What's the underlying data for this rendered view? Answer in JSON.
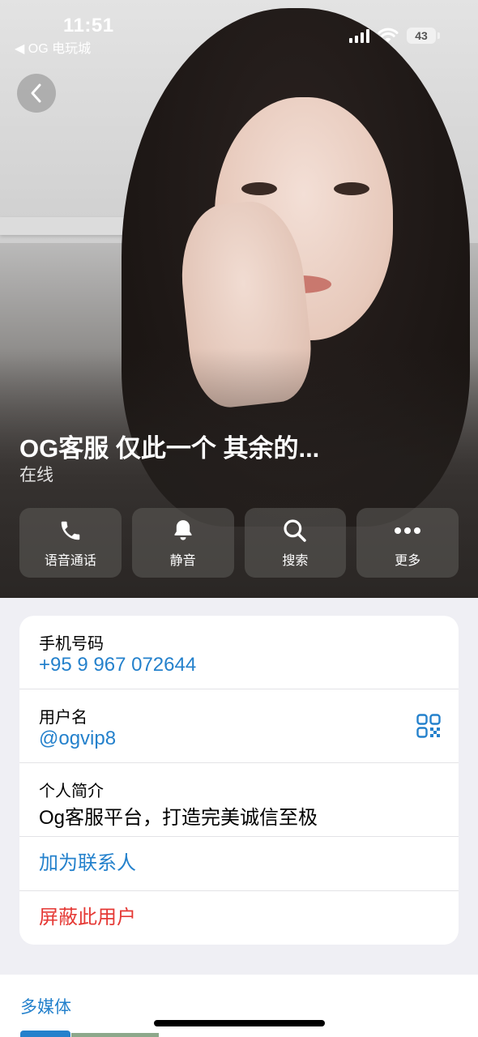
{
  "status_bar": {
    "time": "11:51",
    "back_app": "◀ OG 电玩城",
    "battery": "43"
  },
  "profile": {
    "name": "OG客服 仅此一个 其余的...",
    "status": "在线"
  },
  "actions": [
    {
      "label": "语音通话",
      "icon": "phone-icon"
    },
    {
      "label": "静音",
      "icon": "bell-icon"
    },
    {
      "label": "搜索",
      "icon": "search-icon"
    },
    {
      "label": "更多",
      "icon": "more-icon"
    }
  ],
  "info": {
    "phone_title": "手机号码",
    "phone_value": "+95 9 967 072644",
    "username_title": "用户名",
    "username_value": "@ogvip8",
    "bio_title": "个人简介",
    "bio_value": "Og客服平台，打造完美诚信至极",
    "add_contact": "加为联系人",
    "block_user": "屏蔽此用户"
  },
  "media": {
    "tab_label": "多媒体"
  },
  "colors": {
    "accent": "#2481cc",
    "danger": "#e53935",
    "background": "#efeff4"
  }
}
